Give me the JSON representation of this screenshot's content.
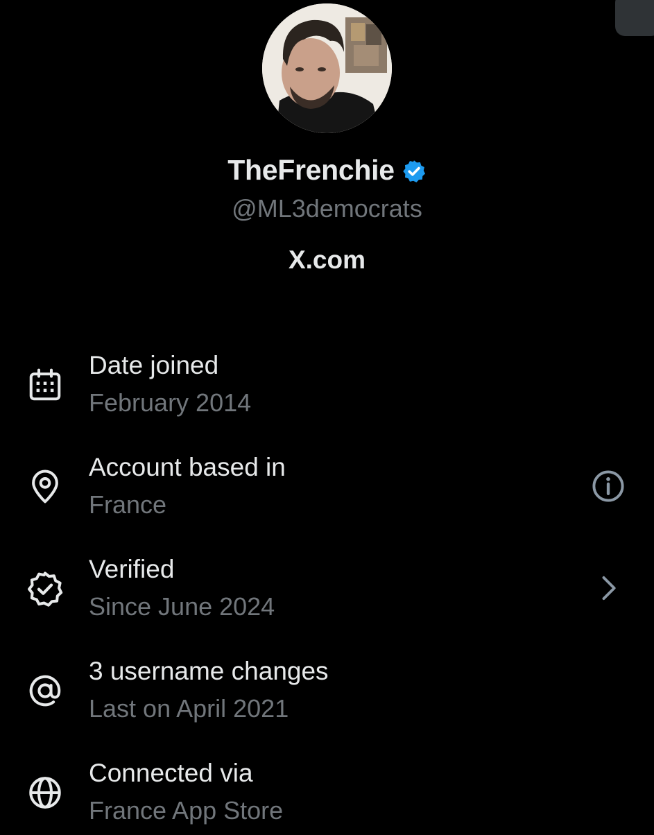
{
  "profile": {
    "name": "TheFrenchie",
    "handle": "@ML3democrats",
    "website": "X.com",
    "verified_badge_icon": "verified-badge-icon",
    "badge_color": "#1d9bf0"
  },
  "about": [
    {
      "icon": "calendar-icon",
      "title": "Date joined",
      "subtitle": "February 2014"
    },
    {
      "icon": "location-pin-icon",
      "title": "Account based in",
      "subtitle": "France",
      "trailing_icon": "info-icon"
    },
    {
      "icon": "verified-shield-icon",
      "title": "Verified",
      "subtitle": "Since June 2024",
      "trailing_icon": "chevron-right-icon"
    },
    {
      "icon": "at-sign-icon",
      "title": "3 username changes",
      "subtitle": "Last on April 2021"
    },
    {
      "icon": "globe-icon",
      "title": "Connected via",
      "subtitle": "France App Store"
    }
  ],
  "colors": {
    "background": "#000000",
    "primary_text": "#e7e9ea",
    "secondary_text": "#71767b"
  }
}
